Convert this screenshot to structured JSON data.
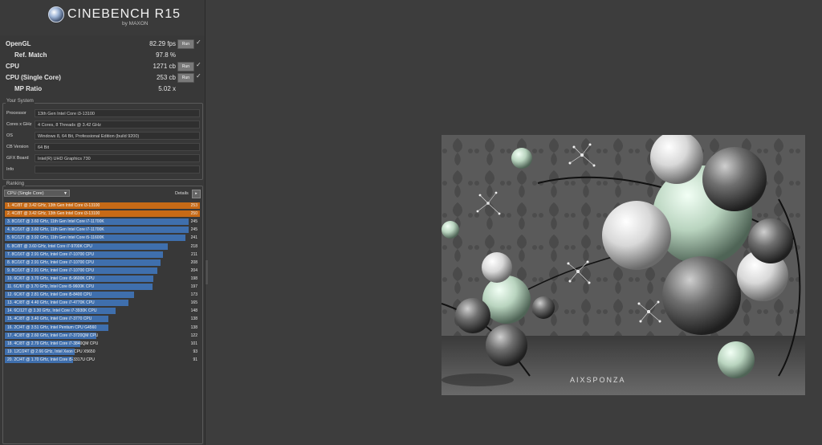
{
  "header": {
    "title": "CINEBENCH R15",
    "subtitle": "by MAXON"
  },
  "scores": [
    {
      "label": "OpenGL",
      "value": "82.29 fps",
      "run": "Run",
      "checked": true,
      "sub": false
    },
    {
      "label": "Ref. Match",
      "value": "97.8 %",
      "run": "",
      "checked": false,
      "sub": true
    },
    {
      "label": "CPU",
      "value": "1271 cb",
      "run": "Run",
      "checked": true,
      "sub": false
    },
    {
      "label": "CPU (Single Core)",
      "value": "253 cb",
      "run": "Run",
      "checked": true,
      "sub": false
    },
    {
      "label": "MP Ratio",
      "value": "5.02 x",
      "run": "",
      "checked": false,
      "sub": true
    }
  ],
  "system": {
    "title": "Your System",
    "rows": [
      {
        "label": "Processor",
        "value": "13th Gen Intel Core i3-13100"
      },
      {
        "label": "Cores x GHz",
        "value": "4 Cores, 8 Threads @ 3.42 GHz"
      },
      {
        "label": "OS",
        "value": "Windows 8, 64 Bit, Professional Edition (build 9200)"
      },
      {
        "label": "CB Version",
        "value": "64 Bit"
      },
      {
        "label": "GFX Board",
        "value": "Intel(R) UHD Graphics 730"
      },
      {
        "label": "Info",
        "value": ""
      }
    ]
  },
  "ranking": {
    "title": "Ranking",
    "dropdown": "CPU (Single Core)",
    "details": "Details",
    "details_icon": "▸",
    "max": 253,
    "colors": {
      "highlight": "#c76a16",
      "normal": "#3f6fad"
    },
    "items": [
      {
        "text": "1. 4C/8T @ 3.42 GHz, 13th Gen Intel Core i3-13100",
        "score": 253,
        "highlight": true
      },
      {
        "text": "2. 4C/8T @ 3.42 GHz, 13th Gen Intel Core i3-13100",
        "score": 250,
        "highlight": true
      },
      {
        "text": "3. 8C/16T @ 3.60 GHz, 11th Gen Intel Core i7-11700K",
        "score": 245,
        "highlight": false
      },
      {
        "text": "4. 8C/16T @ 3.60 GHz, 11th Gen Intel Core i7-11700K",
        "score": 245,
        "highlight": false
      },
      {
        "text": "5. 6C/12T @ 3.92 GHz, 11th Gen Intel Core i5-11600K",
        "score": 241,
        "highlight": false
      },
      {
        "text": "6. 8C/8T @ 3.60 GHz, Intel Core i7-9700K CPU",
        "score": 218,
        "highlight": false
      },
      {
        "text": "7. 8C/16T @ 2.91 GHz, Intel Core i7-10700 CPU",
        "score": 211,
        "highlight": false
      },
      {
        "text": "8. 8C/16T @ 2.91 GHz, Intel Core i7-10700 CPU",
        "score": 208,
        "highlight": false
      },
      {
        "text": "9. 8C/16T @ 2.91 GHz, Intel Core i7-10700 CPU",
        "score": 204,
        "highlight": false
      },
      {
        "text": "10. 6C/6T @ 3.70 GHz, Intel Core i5-9600K CPU",
        "score": 198,
        "highlight": false
      },
      {
        "text": "11. 6C/6T @ 3.70 GHz, Intel Core i5-9600K CPU",
        "score": 197,
        "highlight": false
      },
      {
        "text": "12. 6C/6T @ 2.81 GHz, Intel Core i5-8400 CPU",
        "score": 173,
        "highlight": false
      },
      {
        "text": "13. 4C/8T @ 4.40 GHz, Intel Core i7-4770K CPU",
        "score": 165,
        "highlight": false
      },
      {
        "text": "14. 6C/12T @ 3.30 GHz, Intel Core i7-3930K CPU",
        "score": 148,
        "highlight": false
      },
      {
        "text": "15. 4C/8T @ 3.40 GHz, Intel Core i7-3770 CPU",
        "score": 138,
        "highlight": false
      },
      {
        "text": "16. 2C/4T @ 3.51 GHz, Intel Pentium CPU G4560",
        "score": 138,
        "highlight": false
      },
      {
        "text": "17. 4C/8T @ 2.60 GHz, Intel Core i7-3720QM CPU",
        "score": 122,
        "highlight": false
      },
      {
        "text": "18. 4C/8T @ 2.79 GHz, Intel Core i7-3840QM CPU",
        "score": 101,
        "highlight": false
      },
      {
        "text": "19. 12C/24T @ 2.66 GHz, Intel Xeon CPU X5650",
        "score": 93,
        "highlight": false
      },
      {
        "text": "20. 2C/4T @ 1.70 GHz, Intel Core i5-3317U CPU",
        "score": 91,
        "highlight": false
      }
    ]
  },
  "render": {
    "watermark": "AIXSPONZA"
  }
}
